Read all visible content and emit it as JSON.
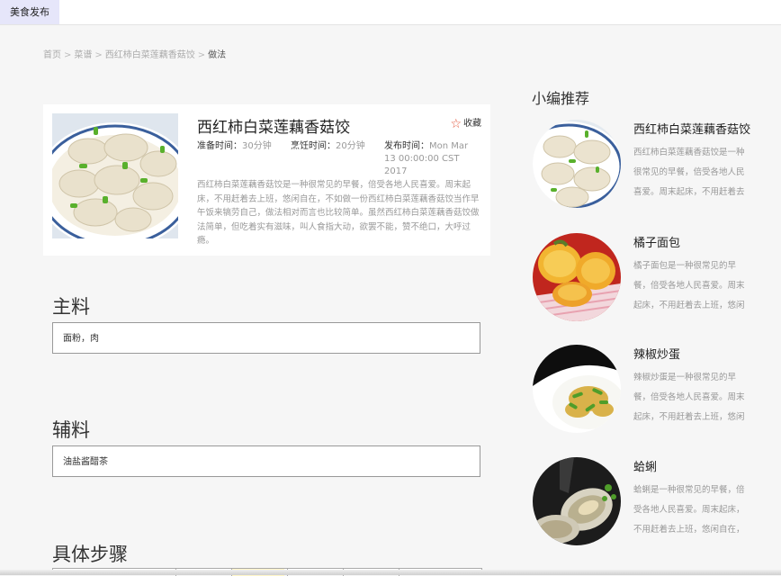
{
  "topbar": {
    "tab_label": "美食发布"
  },
  "breadcrumb": {
    "items": [
      "首页",
      "菜谱",
      "西红柿白菜莲藕香菇饺"
    ],
    "separator": ">",
    "current": "做法"
  },
  "recipe": {
    "title": "西红柿白菜莲藕香菇饺",
    "favorite_label": "收藏",
    "prep_label": "准备时间：",
    "prep_value": "30分钟",
    "cook_label": "烹饪时间：",
    "cook_value": "20分钟",
    "publish_label": "发布时间：",
    "publish_value": "Mon Mar 13 00:00:00 CST 2017",
    "description": "西红柿白菜莲藕香菇饺是一种很常见的早餐，倍受各地人民喜爱。周末起床，不用赶着去上班，悠闲自在，不如做一份西红柿白菜莲藕香菇饺当作早午饭来犒劳自己，做法相对而言也比较简单。虽然西红柿白菜莲藕香菇饺做法简单，但吃着实有滋味，叫人食指大动，欲罢不能，赞不绝口，大呼过瘾。"
  },
  "main_ingredients": {
    "title": "主料",
    "value": "面粉，肉"
  },
  "side_ingredients": {
    "title": "辅料",
    "value": "油盐酱醋茶"
  },
  "steps": {
    "title": "具体步骤"
  },
  "sidebar": {
    "title": "小编推荐",
    "items": [
      {
        "title": "西红柿白菜莲藕香菇饺",
        "desc": "西红柿白菜莲藕香菇饺是一种很常见的早餐，倍受各地人民喜爱。周末起床，不用赶着去",
        "image": "dumplings-photo"
      },
      {
        "title": "橘子面包",
        "desc": "橘子面包是一种很常见的早餐，倍受各地人民喜爱。周末起床，不用赶着去上班，悠闲",
        "image": "orange-bread-photo"
      },
      {
        "title": "辣椒炒蛋",
        "desc": "辣椒炒蛋是一种很常见的早餐，倍受各地人民喜爱。周末起床，不用赶着去上班，悠闲",
        "image": "pepper-egg-photo"
      },
      {
        "title": "蛤蜊",
        "desc": "蛤蜊是一种很常见的早餐，倍受各地人民喜爱。周末起床，不用赶着去上班，悠闲自在，",
        "image": "clam-photo"
      }
    ]
  },
  "colors": {
    "accent_tab": "#e6e6fa",
    "favorite_star": "#e3543a",
    "page_bg": "#f6f6f6"
  }
}
